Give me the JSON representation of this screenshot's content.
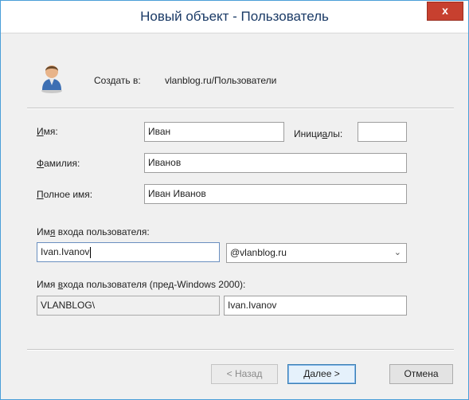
{
  "window": {
    "title": "Новый объект - Пользователь",
    "close_glyph": "x"
  },
  "location": {
    "label": "Создать в:",
    "value": "vlanblog.ru/Пользователи"
  },
  "form": {
    "first_name": {
      "label": "Имя:",
      "value": "Иван"
    },
    "initials": {
      "label": "Инициалы:",
      "value": ""
    },
    "last_name": {
      "label": "Фамилия:",
      "value": "Иванов"
    },
    "full_name": {
      "label": "Полное имя:",
      "value": "Иван Иванов"
    },
    "logon": {
      "label": "Имя входа пользователя:",
      "value": "Ivan.Ivanov",
      "domain": "@vlanblog.ru"
    },
    "logon_pre2000": {
      "label": "Имя входа пользователя (пред-Windows 2000):",
      "domain": "VLANBLOG\\",
      "value": "Ivan.Ivanov"
    }
  },
  "buttons": {
    "back": "< Назад",
    "next": "Далее >",
    "cancel": "Отмена"
  }
}
